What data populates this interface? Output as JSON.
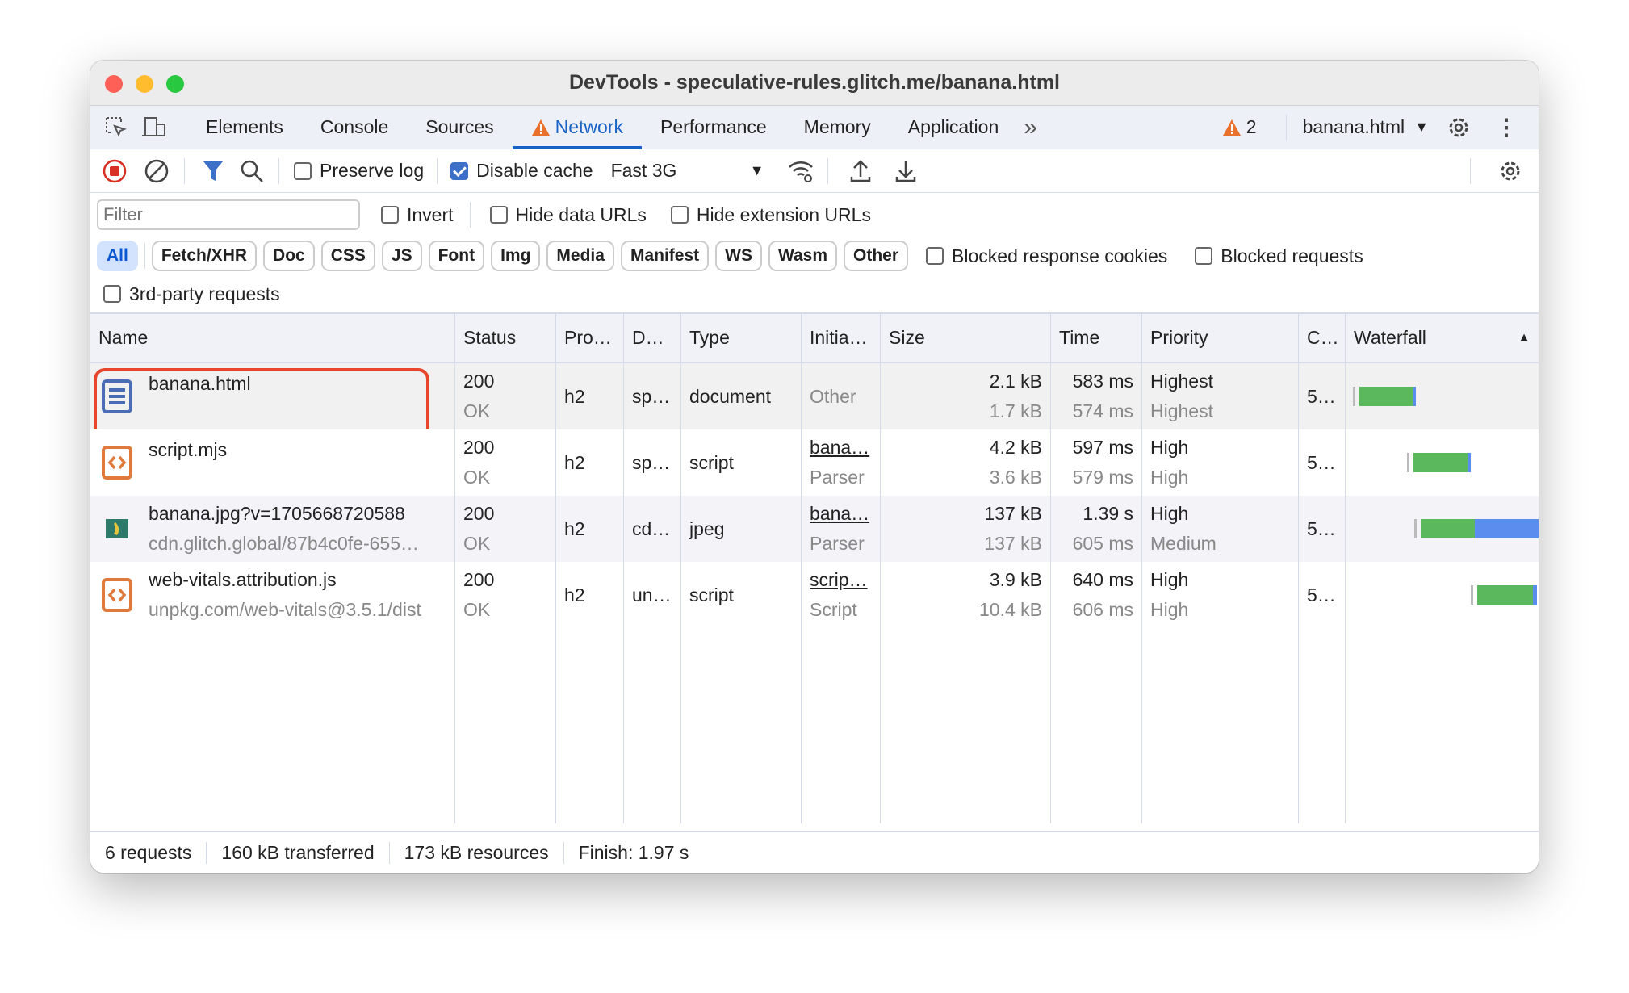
{
  "window": {
    "title": "DevTools - speculative-rules.glitch.me/banana.html"
  },
  "tabs": [
    {
      "label": "Elements"
    },
    {
      "label": "Console"
    },
    {
      "label": "Sources"
    },
    {
      "label": "Network",
      "active": true,
      "icon": "warning-icon"
    },
    {
      "label": "Performance"
    },
    {
      "label": "Memory"
    },
    {
      "label": "Application"
    }
  ],
  "tabbar": {
    "more": "»",
    "warnings": "2",
    "context": "banana.html"
  },
  "toolbar": {
    "preserve_log": "Preserve log",
    "preserve_log_checked": false,
    "disable_cache": "Disable cache",
    "disable_cache_checked": true,
    "throttling": "Fast 3G"
  },
  "filters": {
    "placeholder": "Filter",
    "invert": "Invert",
    "hide_data_urls": "Hide data URLs",
    "hide_extension_urls": "Hide extension URLs",
    "types": [
      "All",
      "Fetch/XHR",
      "Doc",
      "CSS",
      "JS",
      "Font",
      "Img",
      "Media",
      "Manifest",
      "WS",
      "Wasm",
      "Other"
    ],
    "active_type": "All",
    "blocked_cookies": "Blocked response cookies",
    "blocked_requests": "Blocked requests",
    "third_party": "3rd-party requests"
  },
  "columns": [
    "Name",
    "Status",
    "Pro…",
    "D…",
    "Type",
    "Initia…",
    "Size",
    "Time",
    "Priority",
    "C…",
    "Waterfall"
  ],
  "rows": [
    {
      "name": "banana.html",
      "sub": "",
      "status": "200",
      "status_text": "OK",
      "protocol": "h2",
      "domain": "sp…",
      "type": "document",
      "initiator": "Other",
      "initiator_sub": "",
      "size": "2.1 kB",
      "resource": "1.7 kB",
      "time": "583 ms",
      "latency": "574 ms",
      "priority": "Highest",
      "initial_priority": "Highest",
      "c": "5…",
      "icon": "document-icon",
      "waterfall": {
        "start": 0.07,
        "green_end": 0.35,
        "end": 0.36
      }
    },
    {
      "name": "script.mjs",
      "sub": "",
      "status": "200",
      "status_text": "OK",
      "protocol": "h2",
      "domain": "sp…",
      "type": "script",
      "initiator": "bana…",
      "initiator_sub": "Parser",
      "size": "4.2 kB",
      "resource": "3.6 kB",
      "time": "597 ms",
      "latency": "579 ms",
      "priority": "High",
      "initial_priority": "High",
      "c": "5…",
      "icon": "script-icon",
      "waterfall": {
        "start": 0.35,
        "green_end": 0.63,
        "end": 0.65
      }
    },
    {
      "name": "banana.jpg?v=1705668720588",
      "sub": "cdn.glitch.global/87b4c0fe-655…",
      "status": "200",
      "status_text": "OK",
      "protocol": "h2",
      "domain": "cd…",
      "type": "jpeg",
      "initiator": "bana…",
      "initiator_sub": "Parser",
      "size": "137 kB",
      "resource": "137 kB",
      "time": "1.39 s",
      "latency": "605 ms",
      "priority": "High",
      "initial_priority": "Medium",
      "c": "5…",
      "icon": "image-icon",
      "waterfall": {
        "start": 0.39,
        "green_end": 0.67,
        "end": 1.0
      }
    },
    {
      "name": "web-vitals.attribution.js",
      "sub": "unpkg.com/web-vitals@3.5.1/dist",
      "status": "200",
      "status_text": "OK",
      "protocol": "h2",
      "domain": "un…",
      "type": "script",
      "initiator": "scrip…",
      "initiator_sub": "Script",
      "size": "3.9 kB",
      "resource": "10.4 kB",
      "time": "640 ms",
      "latency": "606 ms",
      "priority": "High",
      "initial_priority": "High",
      "c": "5…",
      "icon": "script-icon",
      "waterfall": {
        "start": 0.68,
        "green_end": 0.97,
        "end": 0.99
      }
    }
  ],
  "statusbar": {
    "requests": "6 requests",
    "transferred": "160 kB transferred",
    "resources": "173 kB resources",
    "finish": "Finish: 1.97 s"
  },
  "colors": {
    "accent": "#1a63c6",
    "highlight": "#e8452c",
    "waterfall_wait": "#5cb85c",
    "waterfall_download": "#5b8def"
  }
}
